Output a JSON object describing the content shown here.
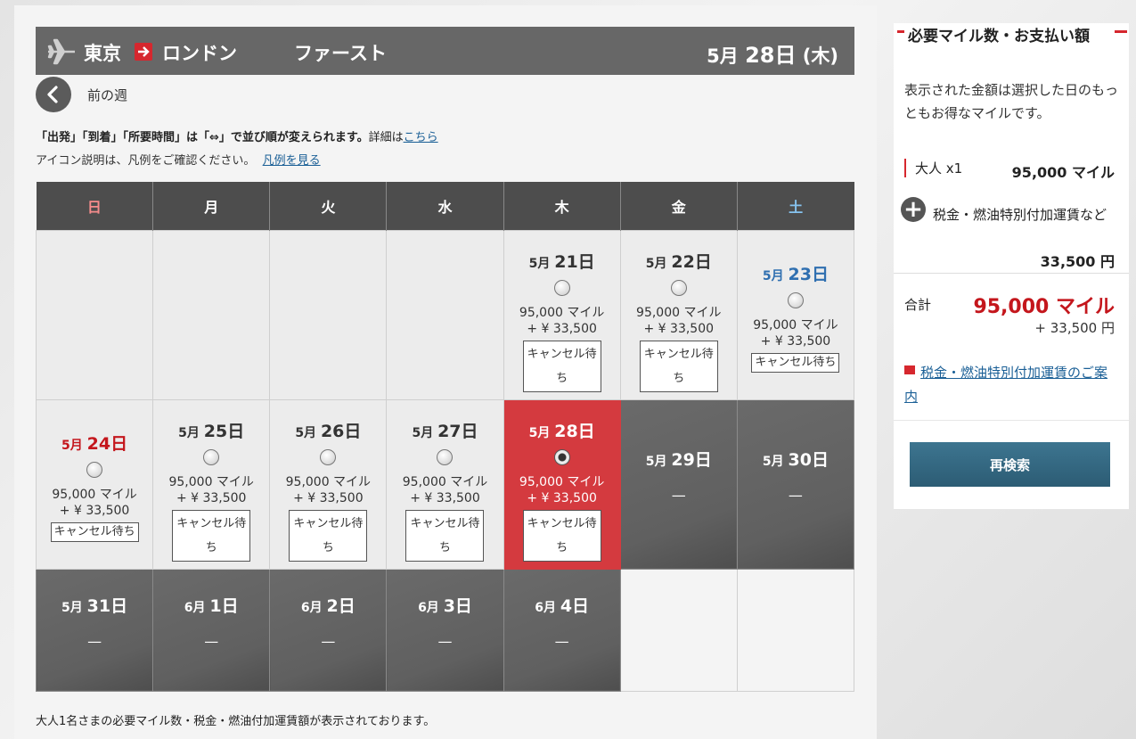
{
  "header": {
    "origin": "東京",
    "destination": "ロンドン",
    "cabin": "ファースト",
    "date_month": "5月",
    "date_day": "28日",
    "date_weekday": "(木)"
  },
  "nav": {
    "prev_week": "前の週"
  },
  "notes": {
    "sort_text": "「出発」「到着」「所要時間」は「⇔」で並び順が変えられます。",
    "detail_prefix": "詳細は",
    "detail_link": "こちら",
    "legend_text": "アイコン説明は、凡例をご確認ください。",
    "legend_link": "凡例を見る"
  },
  "weekdays": [
    "日",
    "月",
    "火",
    "水",
    "木",
    "金",
    "土"
  ],
  "calendar": {
    "price_miles": "95,000 マイル",
    "price_yen": "+ ¥ 33,500",
    "waitlist": "キャンセル待ち",
    "dash": "—",
    "days": [
      {
        "m": "5月",
        "d": "21日"
      },
      {
        "m": "5月",
        "d": "22日"
      },
      {
        "m": "5月",
        "d": "23日"
      },
      {
        "m": "5月",
        "d": "24日"
      },
      {
        "m": "5月",
        "d": "25日"
      },
      {
        "m": "5月",
        "d": "26日"
      },
      {
        "m": "5月",
        "d": "27日"
      },
      {
        "m": "5月",
        "d": "28日"
      },
      {
        "m": "5月",
        "d": "29日"
      },
      {
        "m": "5月",
        "d": "30日"
      },
      {
        "m": "5月",
        "d": "31日"
      },
      {
        "m": "6月",
        "d": "1日"
      },
      {
        "m": "6月",
        "d": "2日"
      },
      {
        "m": "6月",
        "d": "3日"
      },
      {
        "m": "6月",
        "d": "4日"
      }
    ]
  },
  "footer": {
    "note": "大人1名さまの必要マイル数・税金・燃油付加運賃額が表示されております。"
  },
  "summary": {
    "title": "必要マイル数・お支払い額",
    "description": "表示された金額は選択した日のもっともお得なマイルです。",
    "pax_label": "大人 x1",
    "pax_miles": "95,000 マイル",
    "tax_label": "税金・燃油特別付加運賃など",
    "tax_amount": "33,500 円",
    "total_label": "合計",
    "total_miles": "95,000 マイル",
    "total_yen": "+ 33,500 円",
    "tax_link": "税金・燃油特別付加運賃のご案内",
    "research_button": "再検索"
  },
  "colors": {
    "accent_red": "#d6272e",
    "selected_cell": "#d43a3f",
    "unavailable_cell": "#636363",
    "header_bar": "#676767",
    "button_teal": "#336a83"
  }
}
